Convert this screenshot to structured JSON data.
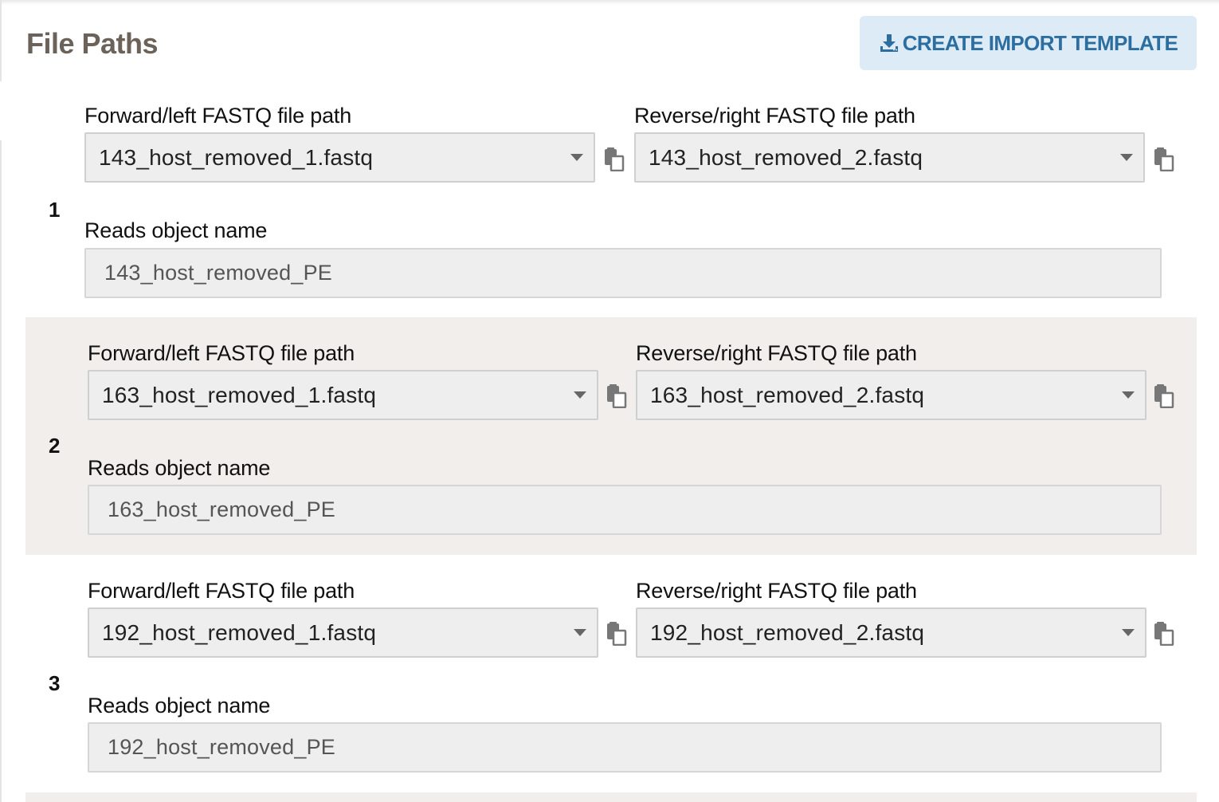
{
  "header": {
    "title": "File Paths",
    "template_button": {
      "label": "CREATE IMPORT TEMPLATE",
      "icon": "download-icon"
    }
  },
  "labels": {
    "forward": "Forward/left FASTQ file path",
    "reverse": "Reverse/right FASTQ file path",
    "reads_name": "Reads object name"
  },
  "rows": [
    {
      "number": "1",
      "forward": "143_host_removed_1.fastq",
      "reverse": "143_host_removed_2.fastq",
      "reads_name": "143_host_removed_PE"
    },
    {
      "number": "2",
      "forward": "163_host_removed_1.fastq",
      "reverse": "163_host_removed_2.fastq",
      "reads_name": "163_host_removed_PE"
    },
    {
      "number": "3",
      "forward": "192_host_removed_1.fastq",
      "reverse": "192_host_removed_2.fastq",
      "reads_name": "192_host_removed_PE"
    }
  ],
  "colors": {
    "title": "#6b6259",
    "button_bg": "#dcebf5",
    "button_text": "#2d6ea0",
    "alt_row_bg": "#f1eeeb",
    "input_bg": "#eeeeee"
  },
  "icons": {
    "copy": "copy-icon",
    "dropdown": "caret-down-icon"
  }
}
